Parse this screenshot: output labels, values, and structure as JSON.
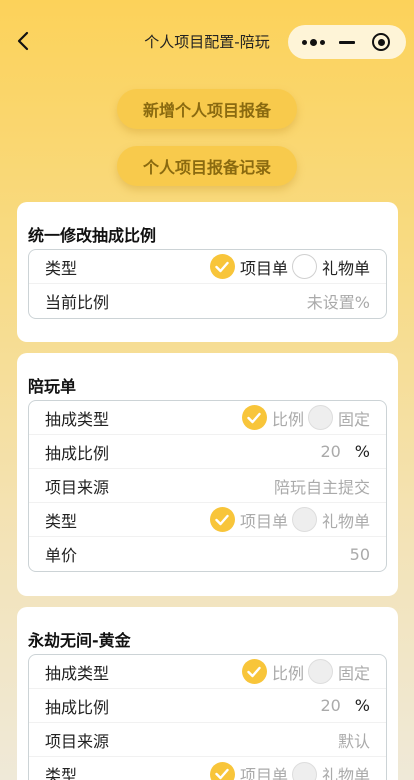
{
  "nav": {
    "title": "个人项目配置-陪玩"
  },
  "buttons": {
    "new_report": "新增个人项目报备",
    "report_records": "个人项目报备记录"
  },
  "accent_color": "#f8c53a",
  "section_unified": {
    "title": "统一修改抽成比例",
    "type_label": "类型",
    "type_options": [
      "项目单",
      "礼物单"
    ],
    "type_selected": "项目单",
    "ratio_label": "当前比例",
    "ratio_value": "未设置%"
  },
  "section_peiwan": {
    "title": "陪玩单",
    "commission_type_label": "抽成类型",
    "commission_options": [
      "比例",
      "固定"
    ],
    "ratio_label": "抽成比例",
    "ratio_value": "20",
    "ratio_unit": "%",
    "source_label": "项目来源",
    "source_value": "陪玩自主提交",
    "type_label": "类型",
    "type_options": [
      "项目单",
      "礼物单"
    ],
    "price_label": "单价",
    "price_value": "50"
  },
  "section_gold": {
    "title": "永劫无间-黄金",
    "commission_type_label": "抽成类型",
    "commission_options": [
      "比例",
      "固定"
    ],
    "ratio_label": "抽成比例",
    "ratio_value": "20",
    "ratio_unit": "%",
    "source_label": "项目来源",
    "source_value": "默认",
    "type_label": "类型",
    "type_options": [
      "项目单",
      "礼物单"
    ]
  }
}
